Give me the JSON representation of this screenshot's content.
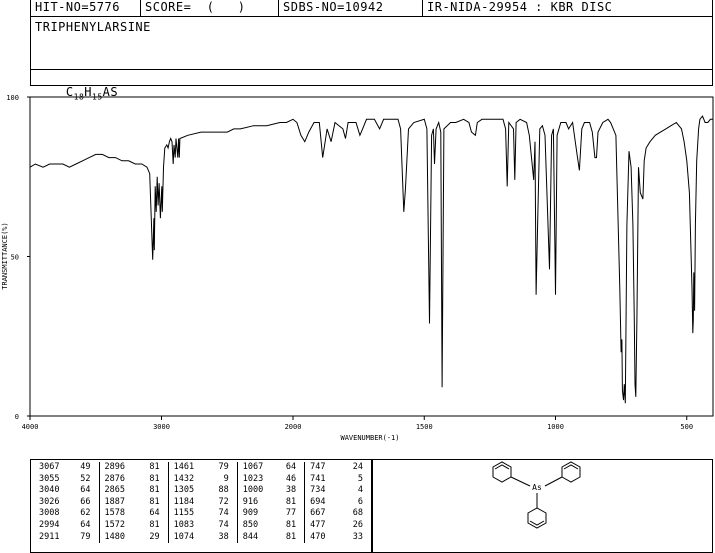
{
  "header": {
    "hit_no": "HIT-NO=5776",
    "score": "SCORE=  (   )",
    "sdbs_no": "SDBS-NO=10942",
    "ir_nida": "IR-NIDA-29954 : KBR DISC"
  },
  "compound": {
    "name": "TRIPHENYLARSINE",
    "formula_c": "C",
    "formula_c_sub": "18",
    "formula_h": "H",
    "formula_h_sub": "15",
    "formula_as": "AS"
  },
  "chart_data": {
    "type": "line",
    "xlabel": "WAVENUMBER(-1)",
    "ylabel": "TRANSMITTANCE(%)",
    "xlim": [
      4000,
      400
    ],
    "ylim": [
      0,
      100
    ],
    "x_ticks": [
      4000,
      3000,
      2000,
      1500,
      1000,
      500
    ],
    "y_ticks": [
      0,
      50,
      100
    ],
    "grid": false,
    "series": [
      {
        "points": [
          [
            4000,
            78
          ],
          [
            3960,
            79
          ],
          [
            3900,
            78
          ],
          [
            3850,
            79
          ],
          [
            3800,
            79
          ],
          [
            3750,
            79
          ],
          [
            3700,
            78
          ],
          [
            3650,
            79
          ],
          [
            3600,
            80
          ],
          [
            3550,
            81
          ],
          [
            3500,
            82
          ],
          [
            3450,
            82
          ],
          [
            3400,
            81
          ],
          [
            3350,
            81
          ],
          [
            3300,
            80
          ],
          [
            3250,
            80
          ],
          [
            3200,
            79
          ],
          [
            3150,
            79
          ],
          [
            3110,
            78
          ],
          [
            3090,
            76
          ],
          [
            3067,
            49
          ],
          [
            3058,
            62
          ],
          [
            3055,
            52
          ],
          [
            3048,
            72
          ],
          [
            3040,
            64
          ],
          [
            3033,
            75
          ],
          [
            3026,
            66
          ],
          [
            3018,
            73
          ],
          [
            3008,
            62
          ],
          [
            2998,
            72
          ],
          [
            2994,
            64
          ],
          [
            2985,
            78
          ],
          [
            2975,
            84
          ],
          [
            2960,
            85
          ],
          [
            2950,
            84
          ],
          [
            2940,
            86
          ],
          [
            2930,
            87
          ],
          [
            2920,
            86
          ],
          [
            2911,
            79
          ],
          [
            2905,
            85
          ],
          [
            2896,
            81
          ],
          [
            2890,
            87
          ],
          [
            2876,
            81
          ],
          [
            2870,
            87
          ],
          [
            2865,
            81
          ],
          [
            2860,
            87
          ],
          [
            2800,
            88
          ],
          [
            2700,
            89
          ],
          [
            2600,
            89
          ],
          [
            2500,
            89
          ],
          [
            2450,
            90
          ],
          [
            2400,
            90
          ],
          [
            2300,
            91
          ],
          [
            2200,
            91
          ],
          [
            2100,
            92
          ],
          [
            2050,
            92
          ],
          [
            2000,
            93
          ],
          [
            1985,
            92
          ],
          [
            1970,
            88
          ],
          [
            1955,
            86
          ],
          [
            1940,
            89
          ],
          [
            1920,
            92
          ],
          [
            1900,
            92
          ],
          [
            1887,
            81
          ],
          [
            1870,
            90
          ],
          [
            1855,
            86
          ],
          [
            1840,
            92
          ],
          [
            1810,
            90
          ],
          [
            1800,
            87
          ],
          [
            1790,
            92
          ],
          [
            1760,
            92
          ],
          [
            1745,
            88
          ],
          [
            1735,
            90
          ],
          [
            1720,
            93
          ],
          [
            1690,
            93
          ],
          [
            1670,
            90
          ],
          [
            1655,
            93
          ],
          [
            1600,
            93
          ],
          [
            1590,
            90
          ],
          [
            1578,
            64
          ],
          [
            1572,
            71
          ],
          [
            1560,
            90
          ],
          [
            1540,
            92
          ],
          [
            1500,
            93
          ],
          [
            1490,
            90
          ],
          [
            1480,
            29
          ],
          [
            1472,
            88
          ],
          [
            1465,
            90
          ],
          [
            1461,
            79
          ],
          [
            1455,
            90
          ],
          [
            1445,
            92
          ],
          [
            1437,
            89
          ],
          [
            1432,
            9
          ],
          [
            1425,
            90
          ],
          [
            1400,
            92
          ],
          [
            1380,
            92
          ],
          [
            1350,
            93
          ],
          [
            1330,
            92
          ],
          [
            1320,
            89
          ],
          [
            1305,
            88
          ],
          [
            1298,
            92
          ],
          [
            1280,
            93
          ],
          [
            1250,
            93
          ],
          [
            1200,
            93
          ],
          [
            1190,
            90
          ],
          [
            1184,
            72
          ],
          [
            1178,
            92
          ],
          [
            1160,
            90
          ],
          [
            1155,
            74
          ],
          [
            1150,
            92
          ],
          [
            1135,
            93
          ],
          [
            1110,
            92
          ],
          [
            1100,
            88
          ],
          [
            1083,
            74
          ],
          [
            1078,
            86
          ],
          [
            1074,
            38
          ],
          [
            1067,
            64
          ],
          [
            1060,
            90
          ],
          [
            1050,
            91
          ],
          [
            1040,
            88
          ],
          [
            1023,
            46
          ],
          [
            1015,
            88
          ],
          [
            1008,
            90
          ],
          [
            1000,
            38
          ],
          [
            994,
            88
          ],
          [
            980,
            92
          ],
          [
            960,
            92
          ],
          [
            950,
            90
          ],
          [
            935,
            92
          ],
          [
            916,
            81
          ],
          [
            909,
            77
          ],
          [
            900,
            90
          ],
          [
            890,
            92
          ],
          [
            870,
            92
          ],
          [
            860,
            89
          ],
          [
            850,
            81
          ],
          [
            844,
            81
          ],
          [
            838,
            89
          ],
          [
            820,
            92
          ],
          [
            800,
            93
          ],
          [
            790,
            92
          ],
          [
            770,
            88
          ],
          [
            755,
            40
          ],
          [
            750,
            20
          ],
          [
            747,
            24
          ],
          [
            745,
            8
          ],
          [
            741,
            5
          ],
          [
            738,
            10
          ],
          [
            734,
            4
          ],
          [
            728,
            60
          ],
          [
            720,
            83
          ],
          [
            712,
            78
          ],
          [
            705,
            60
          ],
          [
            700,
            30
          ],
          [
            697,
            10
          ],
          [
            694,
            6
          ],
          [
            690,
            30
          ],
          [
            684,
            78
          ],
          [
            677,
            70
          ],
          [
            667,
            68
          ],
          [
            662,
            80
          ],
          [
            655,
            84
          ],
          [
            640,
            86
          ],
          [
            620,
            88
          ],
          [
            600,
            89
          ],
          [
            580,
            90
          ],
          [
            560,
            91
          ],
          [
            540,
            92
          ],
          [
            520,
            90
          ],
          [
            510,
            86
          ],
          [
            500,
            80
          ],
          [
            490,
            70
          ],
          [
            485,
            55
          ],
          [
            480,
            40
          ],
          [
            477,
            26
          ],
          [
            475,
            30
          ],
          [
            473,
            45
          ],
          [
            470,
            33
          ],
          [
            467,
            60
          ],
          [
            462,
            80
          ],
          [
            455,
            90
          ],
          [
            450,
            93
          ],
          [
            440,
            94
          ],
          [
            430,
            92
          ],
          [
            420,
            92
          ],
          [
            410,
            93
          ],
          [
            400,
            93
          ]
        ]
      }
    ]
  },
  "peak_table": {
    "columns": [
      [
        [
          "3067",
          "49"
        ],
        [
          "3055",
          "52"
        ],
        [
          "3040",
          "64"
        ],
        [
          "3026",
          "66"
        ],
        [
          "3008",
          "62"
        ],
        [
          "2994",
          "64"
        ],
        [
          "2911",
          "79"
        ]
      ],
      [
        [
          "2896",
          "81"
        ],
        [
          "2876",
          "81"
        ],
        [
          "2865",
          "81"
        ],
        [
          "1887",
          "81"
        ],
        [
          "1578",
          "64"
        ],
        [
          "1572",
          "81"
        ],
        [
          "1480",
          "29"
        ]
      ],
      [
        [
          "1461",
          "79"
        ],
        [
          "1432",
          "9"
        ],
        [
          "1305",
          "88"
        ],
        [
          "1184",
          "72"
        ],
        [
          "1155",
          "74"
        ],
        [
          "1083",
          "74"
        ],
        [
          "1074",
          "38"
        ]
      ],
      [
        [
          "1067",
          "64"
        ],
        [
          "1023",
          "46"
        ],
        [
          "1000",
          "38"
        ],
        [
          "916",
          "81"
        ],
        [
          "909",
          "77"
        ],
        [
          "850",
          "81"
        ],
        [
          "844",
          "81"
        ]
      ],
      [
        [
          "747",
          "24"
        ],
        [
          "741",
          "5"
        ],
        [
          "734",
          "4"
        ],
        [
          "694",
          "6"
        ],
        [
          "667",
          "68"
        ],
        [
          "477",
          "26"
        ],
        [
          "470",
          "33"
        ]
      ]
    ]
  },
  "structure": {
    "atom_label": "As"
  }
}
